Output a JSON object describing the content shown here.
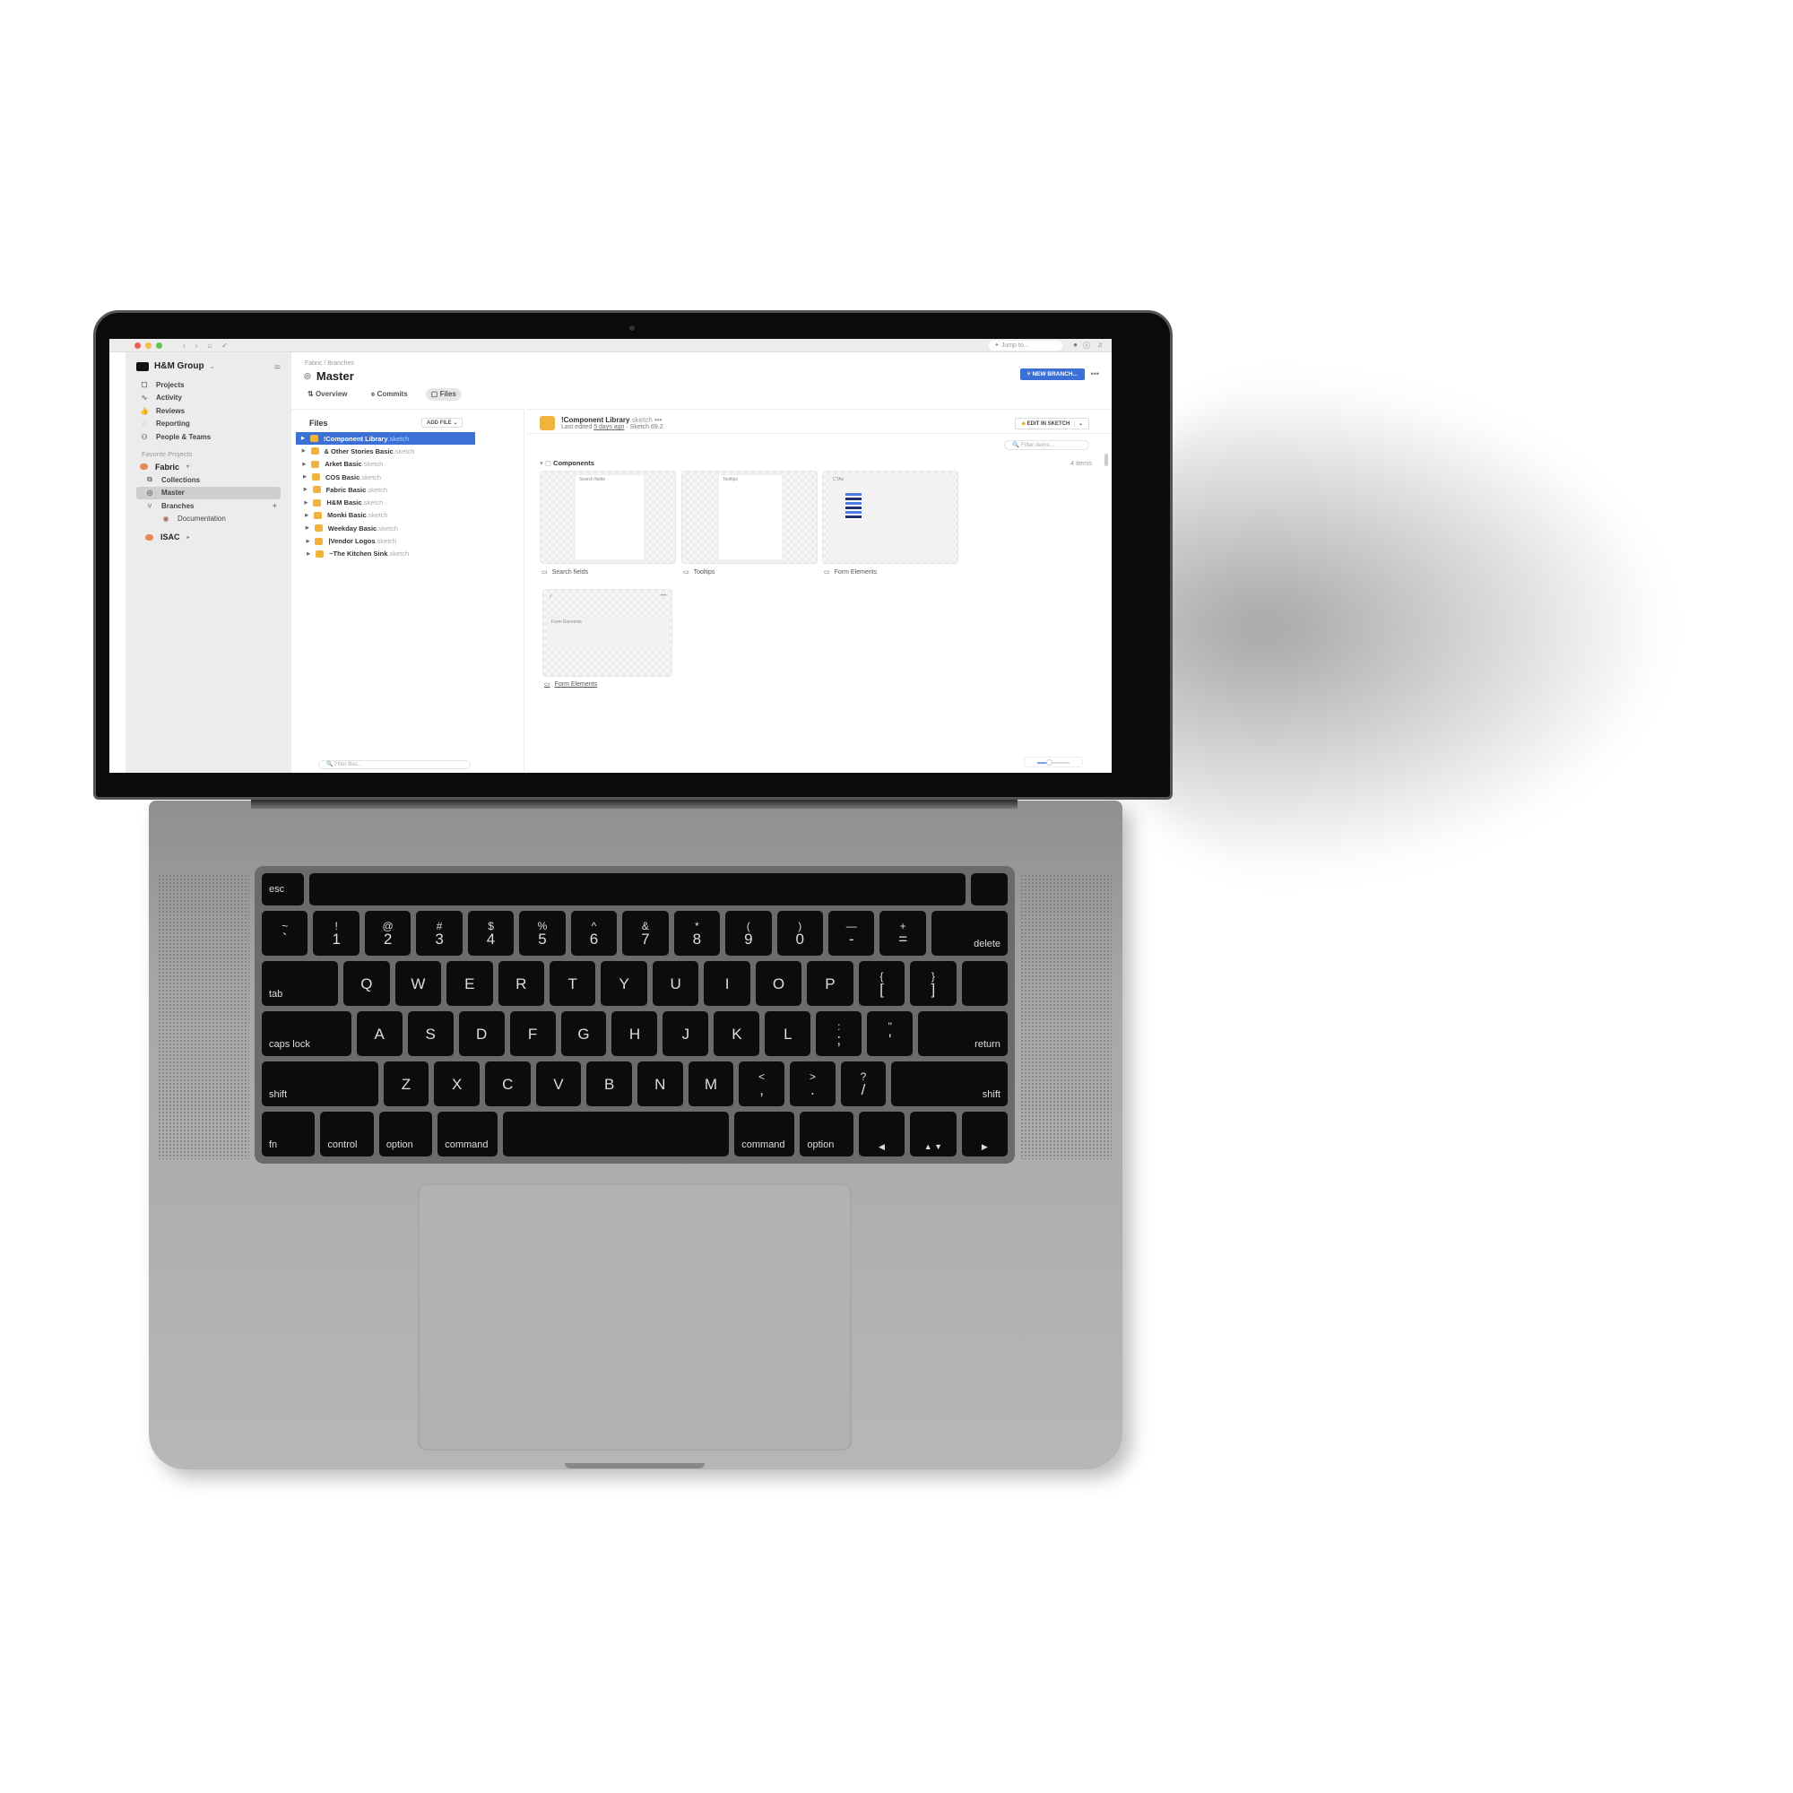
{
  "window": {
    "traffic_lights": [
      "#ee5f57",
      "#f5bd4f",
      "#5fc454"
    ],
    "jump_placeholder": "Jump to...",
    "icons": [
      "back-icon",
      "forward-icon",
      "home-icon",
      "sync-icon",
      "avatar",
      "help-icon",
      "bell-icon"
    ]
  },
  "sidebar": {
    "org": "H&M Group",
    "items": [
      {
        "label": "Projects",
        "icon": "☐"
      },
      {
        "label": "Activity",
        "icon": "∿"
      },
      {
        "label": "Reviews",
        "icon": "👍"
      },
      {
        "label": "Reporting",
        "icon": "◌"
      },
      {
        "label": "People & Teams",
        "icon": "⚇"
      }
    ],
    "favorites_label": "Favorite Projects",
    "project": "Fabric",
    "sub": [
      {
        "label": "Collections"
      },
      {
        "label": "Master"
      },
      {
        "label": "Branches"
      },
      {
        "label": "Documentation"
      }
    ],
    "project2": "ISAC"
  },
  "header": {
    "breadcrumb": "Fabric  /  Branches",
    "title": "Master",
    "tabs": [
      "Overview",
      "Commits",
      "Files"
    ],
    "new_branch": "NEW BRANCH...",
    "accent": "#3b71d6"
  },
  "files": {
    "title": "Files",
    "add_file": "ADD FILE",
    "filter_placeholder": "Filter files...",
    "list": [
      {
        "name": "!Component Library",
        "ext": ".sketch"
      },
      {
        "name": "& Other Stories Basic",
        "ext": ".sketch"
      },
      {
        "name": "Arket Basic",
        "ext": ".sketch"
      },
      {
        "name": "COS Basic",
        "ext": ".sketch"
      },
      {
        "name": "Fabric Basic",
        "ext": ".sketch"
      },
      {
        "name": "H&M Basic",
        "ext": ".sketch"
      },
      {
        "name": "Monki Basic",
        "ext": ".sketch"
      },
      {
        "name": "Weekday Basic",
        "ext": ".sketch"
      },
      {
        "name": "|Vendor Logos",
        "ext": ".sketch"
      },
      {
        "name": "~The Kitchen Sink",
        "ext": ".sketch"
      }
    ]
  },
  "detail": {
    "name": "!Component Library",
    "ext": ".sketch",
    "edited_prefix": "Last edited ",
    "edited": "5 days ago",
    "version": " · Sketch 69.2",
    "edit_button": "EDIT IN SKETCH",
    "filter_placeholder": "Filter items...",
    "section": "Components",
    "count": "4 items",
    "thumbs": [
      {
        "label": "Search fields",
        "art": "Search fields"
      },
      {
        "label": "Tooltips",
        "art": "Tooltips"
      },
      {
        "label": "Form Elements",
        "art": "CTAs"
      },
      {
        "label": "Form Elements",
        "art": "Form Elements"
      }
    ]
  },
  "keyboard": {
    "rows": [
      [
        "esc",
        "",
        "",
        ""
      ],
      [
        "~|`",
        "!|1",
        "@|2",
        "#|3",
        "$|4",
        "%|5",
        "^|6",
        "&|7",
        "*|8",
        "(|9",
        ")|0",
        "—|-",
        "+|=",
        "delete"
      ],
      [
        "tab",
        "Q",
        "W",
        "E",
        "R",
        "T",
        "Y",
        "U",
        "I",
        "O",
        "P",
        "{|[",
        "}|]",
        "||\\"
      ],
      [
        "caps lock",
        "A",
        "S",
        "D",
        "F",
        "G",
        "H",
        "J",
        "K",
        "L",
        ":|;",
        "\"|'",
        "return"
      ],
      [
        "shift",
        "Z",
        "X",
        "C",
        "V",
        "B",
        "N",
        "M",
        "<|,",
        ">|.",
        "?|/",
        "shift"
      ],
      [
        "fn",
        "control",
        "option",
        "command",
        "",
        "command",
        "option",
        "◀",
        "▲ ▼",
        "▶"
      ]
    ]
  }
}
